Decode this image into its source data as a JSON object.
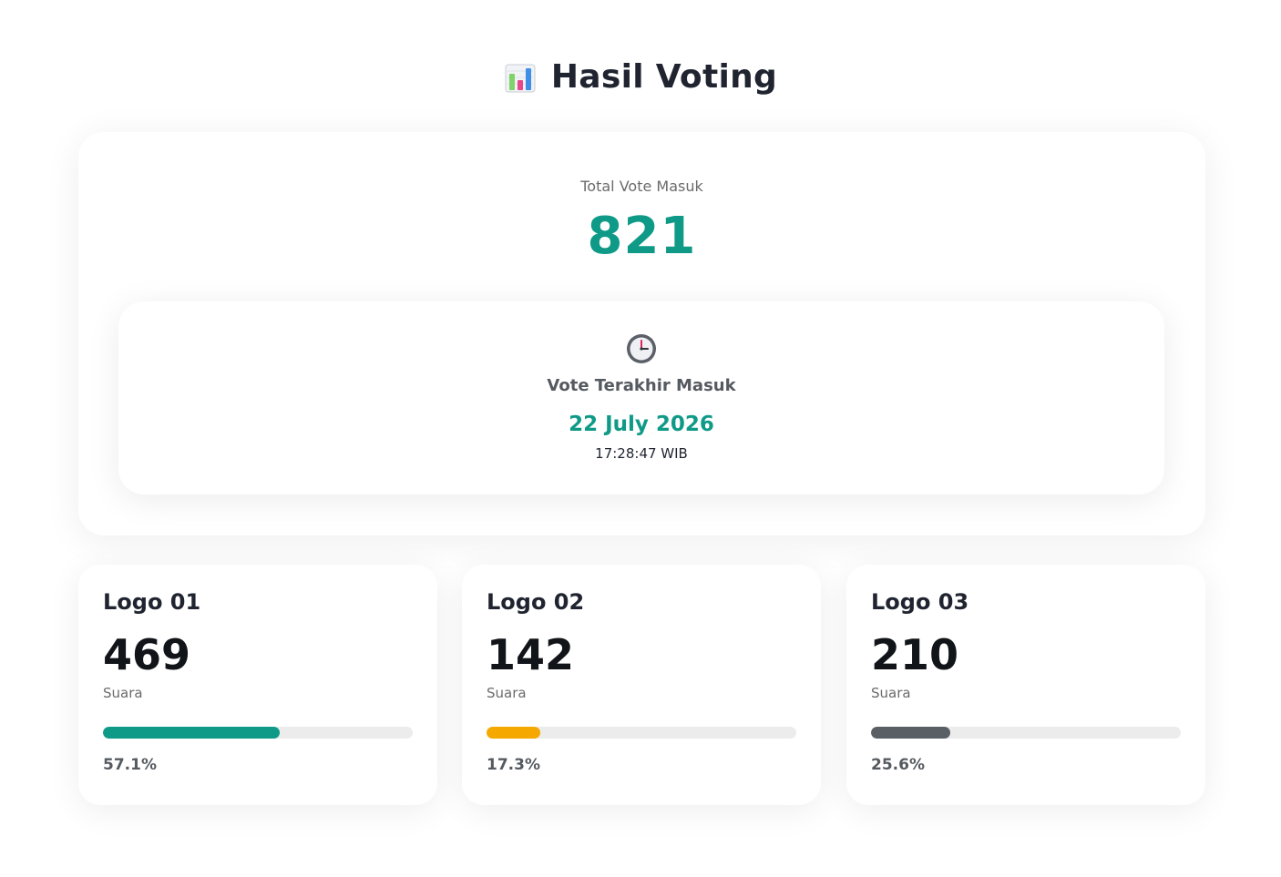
{
  "header": {
    "icon": "bar-chart-icon",
    "title": "Hasil Voting"
  },
  "summary": {
    "total_label": "Total Vote Masuk",
    "total_value": "821",
    "accent_color": "#0f9a88",
    "last_vote": {
      "icon": "clock-icon",
      "label": "Vote Terakhir Masuk",
      "date": "22 July 2026",
      "time": "17:28:47 WIB"
    }
  },
  "candidates": [
    {
      "name": "Logo 01",
      "votes": "469",
      "unit": "Suara",
      "percent_label": "57.1%",
      "percent": 57.1,
      "color": "#0f9a88"
    },
    {
      "name": "Logo 02",
      "votes": "142",
      "unit": "Suara",
      "percent_label": "17.3%",
      "percent": 17.3,
      "color": "#f5a800"
    },
    {
      "name": "Logo 03",
      "votes": "210",
      "unit": "Suara",
      "percent_label": "25.6%",
      "percent": 25.6,
      "color": "#5a5f66"
    }
  ]
}
